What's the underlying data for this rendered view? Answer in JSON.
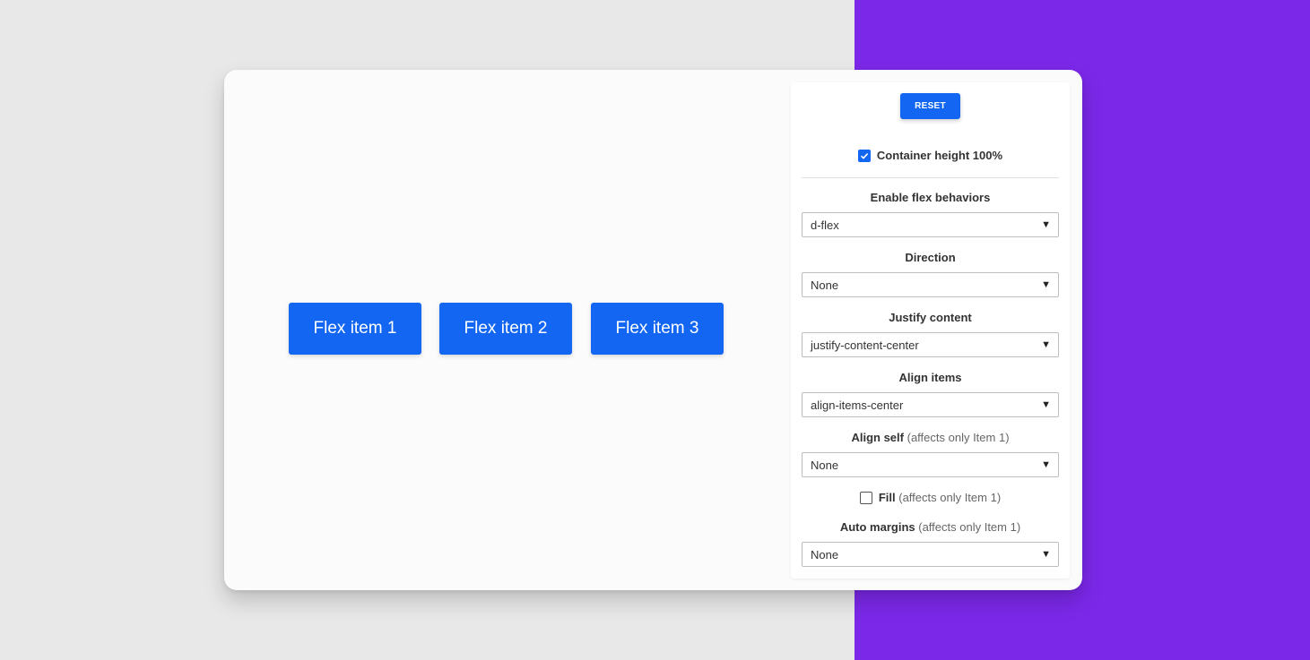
{
  "preview": {
    "items": [
      "Flex item 1",
      "Flex item 2",
      "Flex item 3"
    ]
  },
  "panel": {
    "reset_label": "RESET",
    "container_height_label": "Container height 100%",
    "container_height_checked": true,
    "flex_label": "Enable flex behaviors",
    "flex_value": "d-flex",
    "direction_label": "Direction",
    "direction_value": "None",
    "justify_label": "Justify content",
    "justify_value": "justify-content-center",
    "align_items_label": "Align items",
    "align_items_value": "align-items-center",
    "align_self_label": "Align self",
    "align_self_note": "(affects only Item 1)",
    "align_self_value": "None",
    "fill_label": "Fill",
    "fill_note": "(affects only Item 1)",
    "fill_checked": false,
    "auto_margins_label": "Auto margins",
    "auto_margins_note": "(affects only Item 1)",
    "auto_margins_value": "None"
  },
  "colors": {
    "accent": "#1266f1",
    "purple_background": "#7b28e8",
    "gray_background": "#e8e8e8"
  },
  "icons": {
    "select_arrow": "caret-down-icon",
    "checkbox_checked": "check-icon"
  }
}
